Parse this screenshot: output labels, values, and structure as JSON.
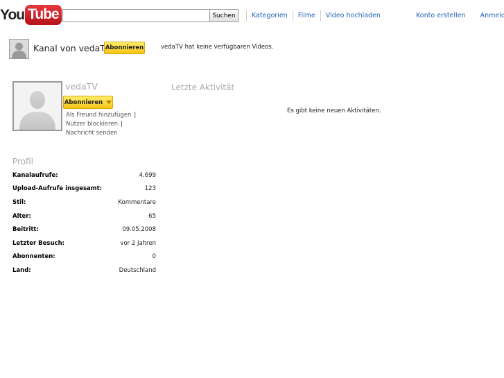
{
  "header": {
    "logo_you": "You",
    "logo_tube": "Tube",
    "search": {
      "value": "",
      "placeholder": "",
      "button_label": "Suchen"
    },
    "nav": [
      {
        "label": "Kategorien"
      },
      {
        "label": "Filme"
      },
      {
        "label": "Video hochladen"
      }
    ],
    "create_account": "Konto erstellen",
    "sign_in": "Anmelden"
  },
  "channel": {
    "title": "Kanal von vedaTV",
    "subscribe_label": "Abonnieren",
    "no_videos_text": "vedaTV hat keine verfügbaren Videos."
  },
  "profile_card": {
    "username": "vedaTV",
    "subscribe_label": "Abonnieren",
    "actions": [
      {
        "label": "Als Freund hinzufügen",
        "separator": "|"
      },
      {
        "label": "Nutzer blockieren",
        "separator": "|"
      },
      {
        "label": "Nachricht senden",
        "separator": ""
      }
    ]
  },
  "profile": {
    "heading": "Profil",
    "rows": [
      {
        "label": "Kanalaufrufe:",
        "value": "4.699"
      },
      {
        "label": "Upload-Aufrufe insgesamt:",
        "value": "123"
      },
      {
        "label": "Stil:",
        "value": "Kommentare"
      },
      {
        "label": "Alter:",
        "value": "65"
      },
      {
        "label": "Beitritt:",
        "value": "09.05.2008"
      },
      {
        "label": "Letzter Besuch:",
        "value": "vor 2 Jahren"
      },
      {
        "label": "Abonnenten:",
        "value": "0"
      },
      {
        "label": "Land:",
        "value": "Deutschland"
      }
    ]
  },
  "activity": {
    "heading": "Letzte Aktivität",
    "empty_text": "Es gibt keine neuen Aktivitäten."
  },
  "colors": {
    "link": "#1c62b9",
    "subscribe_bg": "#f5c518",
    "logo_red": "#cc181e",
    "muted_heading": "#aaaaaa"
  }
}
